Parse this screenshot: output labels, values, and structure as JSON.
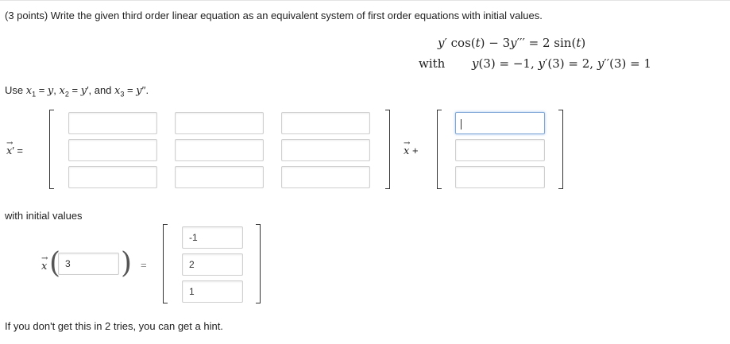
{
  "problem": {
    "statement": "(3 points) Write the given third order linear equation as an equivalent system of first order equations with initial values.",
    "equation": {
      "lhs_y": "y",
      "lhs_prime": "′",
      "cos": " cos(",
      "t1": "t",
      "close1": ") − 3",
      "y2": "y",
      "ppp": "′′′",
      "eq": " = 2 sin(",
      "t2": "t",
      "close2": ")"
    },
    "with_label": "with",
    "initial": {
      "a_y": "y",
      "a_rest": "(3) = −1,  ",
      "b_y": "y",
      "b_rest": "′(3) = 2,  ",
      "c_y": "y",
      "c_rest": "′′(3) = 1"
    }
  },
  "substitution": {
    "use": "Use ",
    "x1": "x",
    "s1": "1",
    "eq1": " = ",
    "y1": "y",
    "comma1": ", ",
    "x2": "x",
    "s2": "2",
    "eq2": " = ",
    "y2": "y",
    "p2": "′",
    "comma2": ", and ",
    "x3": "x",
    "s3": "3",
    "eq3": " = ",
    "y3": "y",
    "p3": "′′",
    "dot": "."
  },
  "system": {
    "lhs_x": "x",
    "lhs_prime": "′",
    "lhs_eq": " =",
    "mid_x": "x",
    "mid_plus": " +",
    "arrow": "→",
    "matrix": [
      [
        "",
        "",
        ""
      ],
      [
        "",
        "",
        ""
      ],
      [
        "",
        "",
        ""
      ]
    ],
    "forcing": [
      "",
      "",
      ""
    ]
  },
  "initial_values": {
    "label": "with initial values",
    "x": "x",
    "t0": "3",
    "eq": "=",
    "values": [
      "-1",
      "2",
      "1"
    ]
  },
  "hint": "If you don't get this in 2 tries, you can get a hint."
}
